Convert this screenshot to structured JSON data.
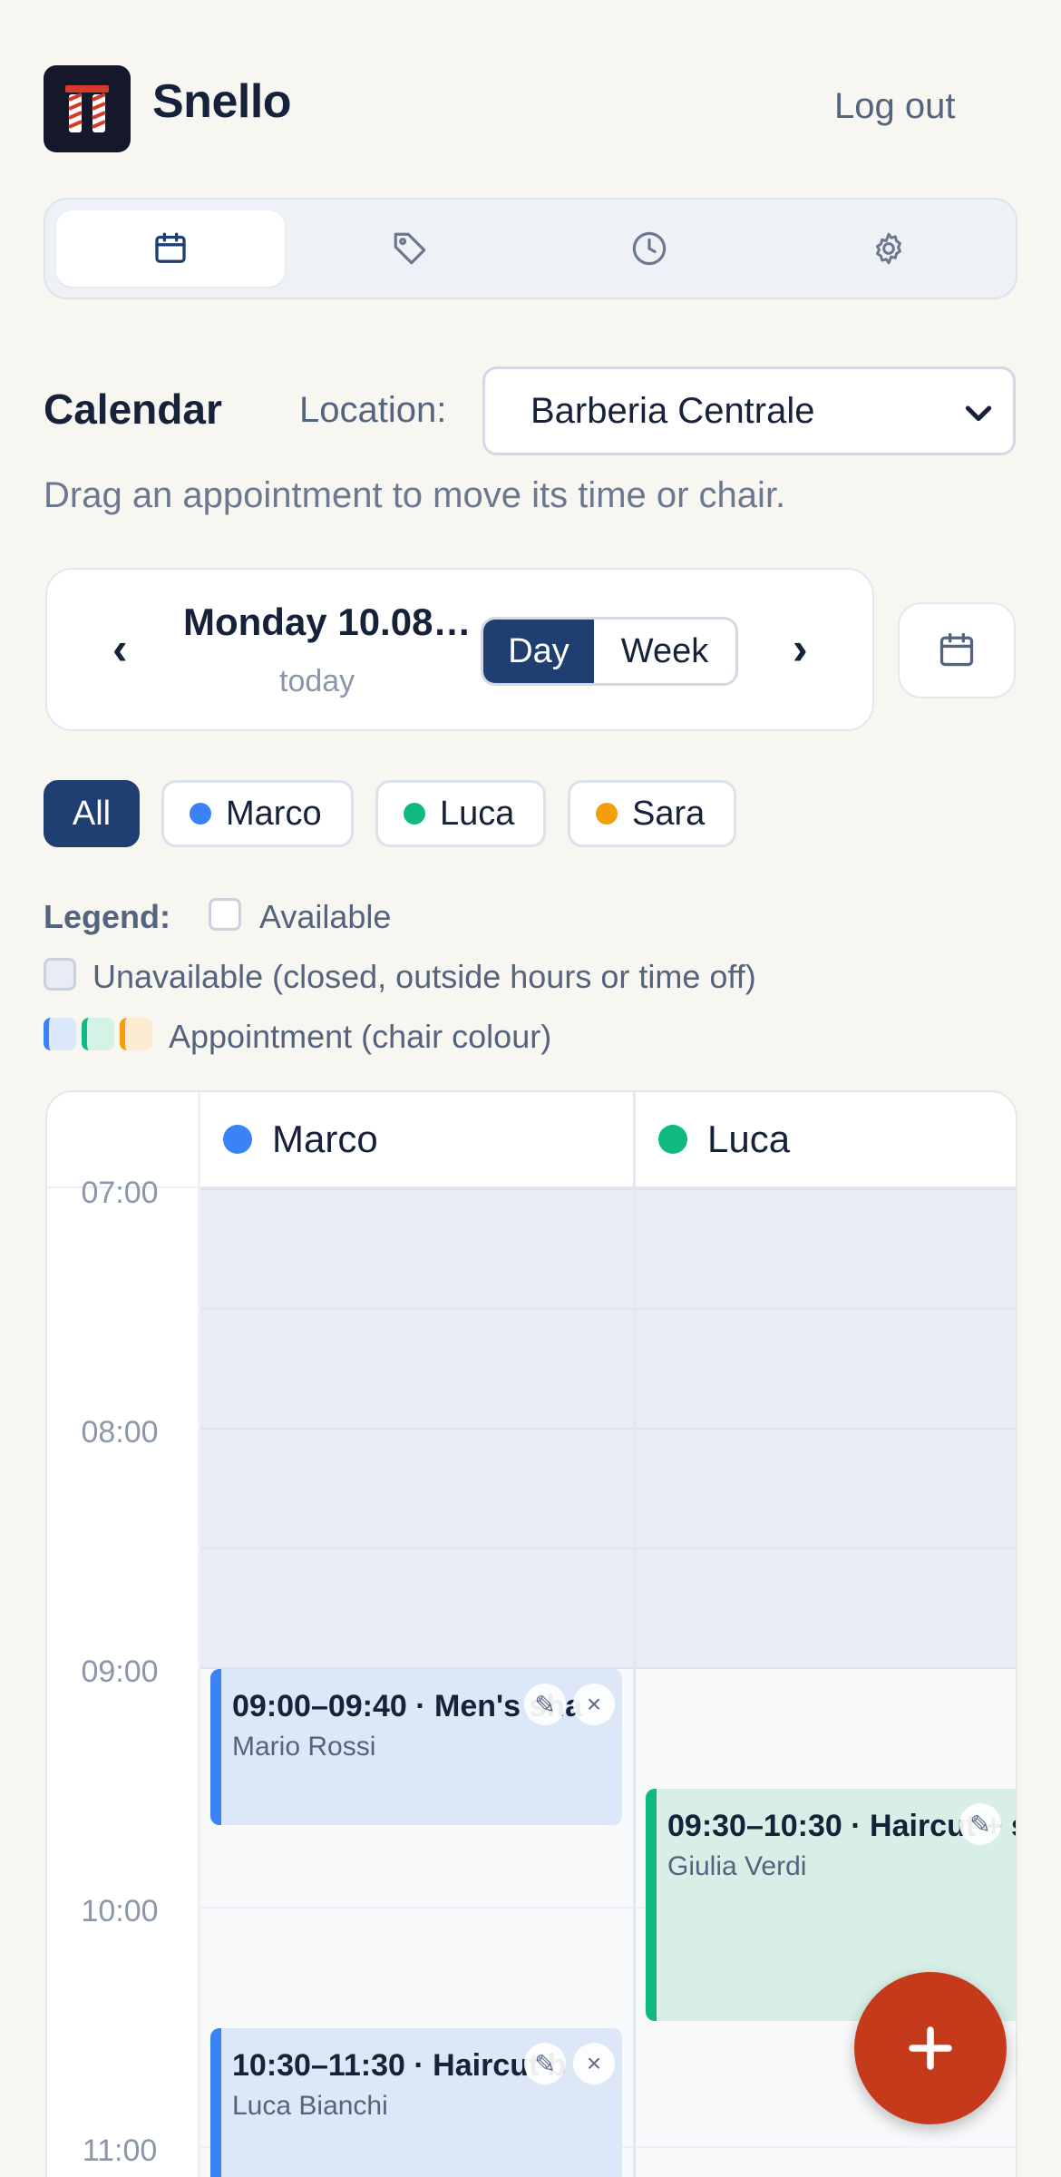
{
  "app": {
    "name": "Snello",
    "logout_label": "Log out"
  },
  "tabs": [
    {
      "name": "calendar",
      "icon": "calendar-icon",
      "active": true
    },
    {
      "name": "services",
      "icon": "tag-icon",
      "active": false
    },
    {
      "name": "hours",
      "icon": "clock-icon",
      "active": false
    },
    {
      "name": "settings",
      "icon": "gear-icon",
      "active": false
    }
  ],
  "calendar": {
    "title": "Calendar",
    "location_label": "Location:",
    "location_value": "Barberia Centrale",
    "hint": "Drag an appointment to move its time or chair.",
    "date_label": "Monday 10.08…",
    "date_sub": "today",
    "prev": "‹",
    "next": "›",
    "view_day": "Day",
    "view_week": "Week",
    "active_view": "Day"
  },
  "filters": {
    "all_label": "All",
    "staff": [
      {
        "name": "Marco",
        "color": "#3b82f6"
      },
      {
        "name": "Luca",
        "color": "#10b981"
      },
      {
        "name": "Sara",
        "color": "#f59e0b"
      }
    ]
  },
  "legend": {
    "label": "Legend:",
    "available": "Available",
    "unavailable": "Unavailable (closed, outside hours or time off)",
    "appointment": "Appointment (chair colour)"
  },
  "grid": {
    "columns": [
      {
        "name": "Marco",
        "color": "#3b82f6"
      },
      {
        "name": "Luca",
        "color": "#10b981"
      }
    ],
    "hours": [
      "07:00",
      "08:00",
      "09:00",
      "10:00",
      "11:00"
    ],
    "appointments": [
      {
        "title": "09:00–09:40 · Men's sha",
        "client": "Mario Rossi",
        "column": "Marco"
      },
      {
        "title": "09:30–10:30 · Haircut + s",
        "client": "Giulia Verdi",
        "column": "Luca"
      },
      {
        "title": "10:30–11:30 · Haircut b",
        "client": "Luca Bianchi",
        "column": "Marco"
      }
    ],
    "edit_glyph": "✎",
    "delete_glyph": "×"
  },
  "fab_label": "+"
}
